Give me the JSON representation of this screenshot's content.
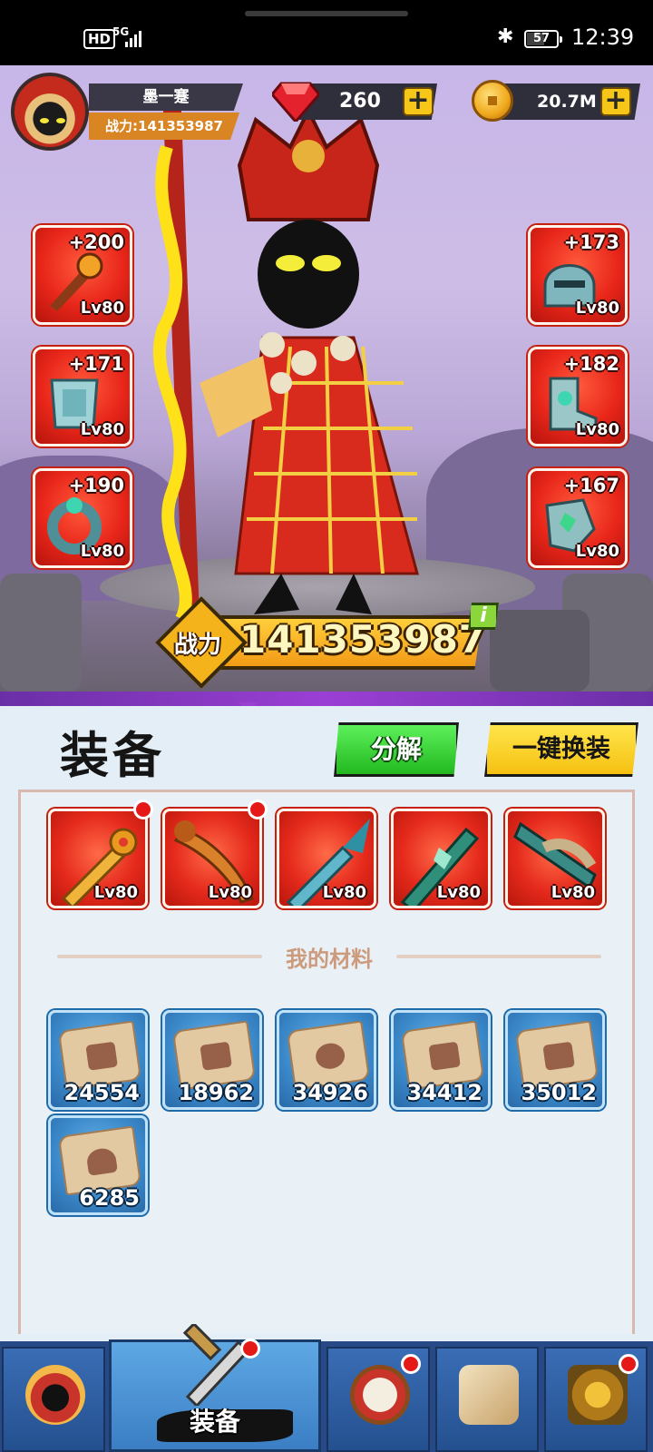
{
  "statusbar": {
    "hd": "HD",
    "network": "5G",
    "battery": "57",
    "time": "12:39"
  },
  "player": {
    "name": "墨一蹇",
    "power_label": "战力:141353987"
  },
  "currency": {
    "gems": "260",
    "gold": "20.7M",
    "plus": "+"
  },
  "gear_slots": [
    {
      "plus": "+200",
      "lv": "Lv80",
      "icon": "staff-icon"
    },
    {
      "plus": "+171",
      "lv": "Lv80",
      "icon": "armor-icon"
    },
    {
      "plus": "+190",
      "lv": "Lv80",
      "icon": "ring-icon"
    },
    {
      "plus": "+173",
      "lv": "Lv80",
      "icon": "helmet-icon"
    },
    {
      "plus": "+182",
      "lv": "Lv80",
      "icon": "boots-icon"
    },
    {
      "plus": "+167",
      "lv": "Lv80",
      "icon": "gauntlet-icon"
    }
  ],
  "combat": {
    "label": "战力",
    "value": "141353987",
    "info": "i"
  },
  "panel": {
    "title": "装备",
    "decompose": "分解",
    "one_click_equip": "一键换装"
  },
  "weapons": [
    {
      "lv": "Lv80",
      "icon": "golden-sword-icon",
      "new": true
    },
    {
      "lv": "Lv80",
      "icon": "dragon-sword-icon",
      "new": true
    },
    {
      "lv": "Lv80",
      "icon": "ice-sword-icon",
      "new": false
    },
    {
      "lv": "Lv80",
      "icon": "jade-sword-icon",
      "new": false
    },
    {
      "lv": "Lv80",
      "icon": "serrated-sword-icon",
      "new": false
    }
  ],
  "materials_header": "我的材料",
  "materials": [
    {
      "count": "24554",
      "icon": "weapon-scroll-icon"
    },
    {
      "count": "18962",
      "icon": "armor-scroll-icon"
    },
    {
      "count": "34926",
      "icon": "ring-scroll-icon"
    },
    {
      "count": "34412",
      "icon": "boots-scroll-icon"
    },
    {
      "count": "35012",
      "icon": "gauntlet-scroll-icon"
    },
    {
      "count": "6285",
      "icon": "helmet-scroll-icon"
    }
  ],
  "nav": {
    "equipment_label": "装备"
  }
}
